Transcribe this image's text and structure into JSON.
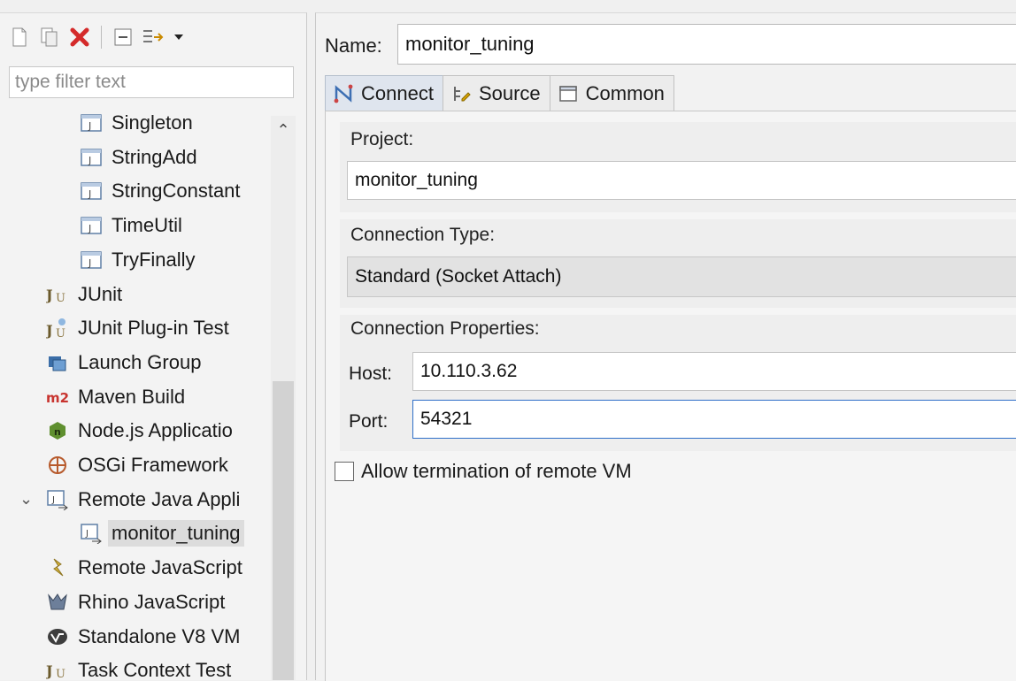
{
  "toolbar": {
    "buttons": [
      {
        "name": "new-launch-configuration-icon"
      },
      {
        "name": "duplicate-icon"
      },
      {
        "name": "delete-icon"
      },
      {
        "name": "collapse-all-icon"
      },
      {
        "name": "filter-configurations-icon"
      },
      {
        "name": "view-menu-chevron-down-icon"
      }
    ]
  },
  "filter": {
    "placeholder": "type filter text",
    "value": ""
  },
  "tree": {
    "items": [
      {
        "label": "Singleton",
        "icon": "java-class-icon",
        "indent": 2
      },
      {
        "label": "StringAdd",
        "icon": "java-class-icon",
        "indent": 2
      },
      {
        "label": "StringConstant",
        "icon": "java-class-icon",
        "indent": 2
      },
      {
        "label": "TimeUtil",
        "icon": "java-class-icon",
        "indent": 2
      },
      {
        "label": "TryFinally",
        "icon": "java-class-icon",
        "indent": 2
      },
      {
        "label": "JUnit",
        "icon": "junit-icon",
        "indent": 1
      },
      {
        "label": "JUnit Plug-in Test",
        "icon": "junit-plugin-icon",
        "indent": 1
      },
      {
        "label": "Launch Group",
        "icon": "launch-group-icon",
        "indent": 1
      },
      {
        "label": "Maven Build",
        "icon": "maven-m2-icon",
        "indent": 1
      },
      {
        "label": "Node.js Applicatio",
        "icon": "nodejs-icon",
        "indent": 1
      },
      {
        "label": "OSGi Framework",
        "icon": "osgi-icon",
        "indent": 1
      },
      {
        "label": "Remote Java Appli",
        "icon": "remote-java-icon",
        "indent": 1,
        "expanded": true
      },
      {
        "label": "monitor_tuning",
        "icon": "remote-java-icon",
        "indent": 2,
        "selected": true
      },
      {
        "label": "Remote JavaScript",
        "icon": "remote-javascript-icon",
        "indent": 1
      },
      {
        "label": "Rhino JavaScript",
        "icon": "rhino-icon",
        "indent": 1
      },
      {
        "label": "Standalone V8 VM",
        "icon": "v8-icon",
        "indent": 1
      },
      {
        "label": "Task Context Test",
        "icon": "junit-icon",
        "indent": 1
      }
    ]
  },
  "editor": {
    "name_label": "Name:",
    "name_value": "monitor_tuning",
    "tabs": [
      {
        "label": "Connect",
        "icon": "connect-icon",
        "active": true
      },
      {
        "label": "Source",
        "icon": "source-icon"
      },
      {
        "label": "Common",
        "icon": "common-icon"
      }
    ],
    "project": {
      "title": "Project:",
      "value": "monitor_tuning"
    },
    "connection_type": {
      "title": "Connection Type:",
      "value": "Standard (Socket Attach)"
    },
    "connection_properties": {
      "title": "Connection Properties:",
      "host_label": "Host:",
      "host_value": "10.110.3.62",
      "port_label": "Port:",
      "port_value": "54321"
    },
    "allow_termination": {
      "label": "Allow termination of remote VM",
      "checked": false
    }
  }
}
